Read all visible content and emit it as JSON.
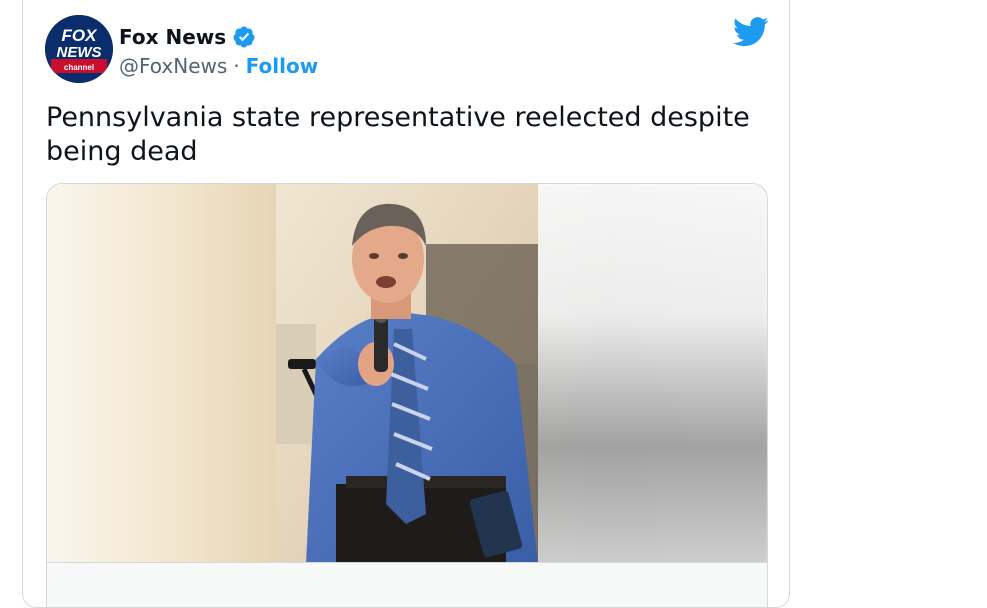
{
  "author": {
    "name": "Fox News",
    "handle": "@FoxNews",
    "separator": "·",
    "follow_label": "Follow",
    "avatar": {
      "logo_text_top": "FOX",
      "logo_text_mid": "NEWS",
      "logo_text_bottom": "channel"
    },
    "verified_icon": "verified-badge-icon"
  },
  "brand_icon": "twitter-bird-icon",
  "tweet": {
    "text": "Pennsylvania state representative reelected despite being dead"
  },
  "media": {
    "subject": "man-speaking-at-microphone-photo"
  },
  "colors": {
    "accent": "#1d9bf0",
    "text_primary": "#0f1419",
    "text_secondary": "#536471",
    "border": "#cfd9de"
  }
}
